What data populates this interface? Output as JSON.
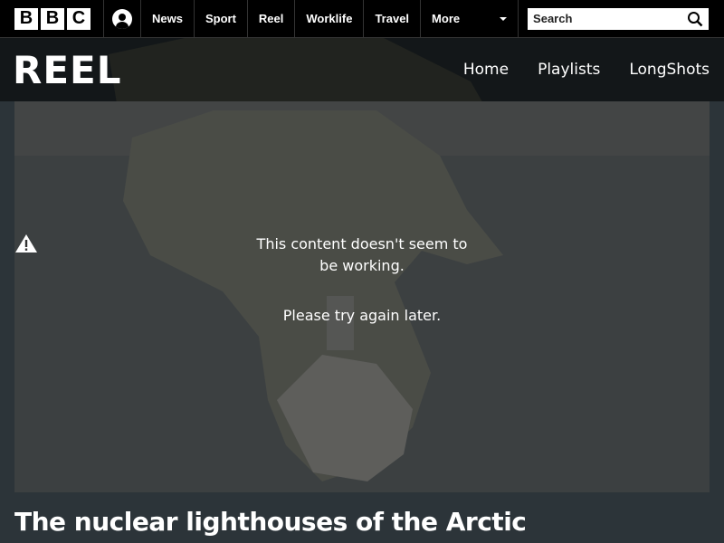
{
  "topbar": {
    "logo_letters": [
      "B",
      "B",
      "C"
    ],
    "account_icon": "account-icon",
    "nav": [
      {
        "label": "News"
      },
      {
        "label": "Sport"
      },
      {
        "label": "Reel"
      },
      {
        "label": "Worklife"
      },
      {
        "label": "Travel"
      }
    ],
    "more_label": "More",
    "search": {
      "placeholder": "Search",
      "icon": "search-icon"
    }
  },
  "reel": {
    "logo": "REEL",
    "nav": [
      "Home",
      "Playlists",
      "LongShots"
    ]
  },
  "player": {
    "error_icon": "warning-icon",
    "error_message": "This content doesn't seem to be working.",
    "retry_message": "Please try again later."
  },
  "video": {
    "title": "The nuclear lighthouses of the Arctic"
  },
  "colors": {
    "topbar_bg": "#000000",
    "text": "#ffffff"
  }
}
